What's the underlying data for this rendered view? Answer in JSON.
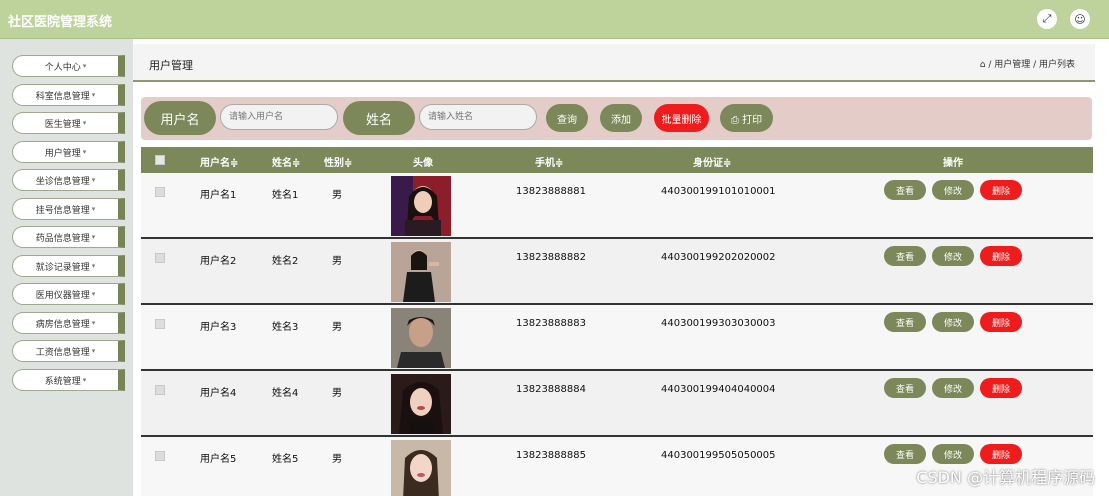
{
  "app_title": "社区医院管理系统",
  "topbar": {
    "fullscreen_icon": "fullscreen-icon",
    "user_icon": "user-icon"
  },
  "sidebar": {
    "items": [
      {
        "label": "个人中心"
      },
      {
        "label": "科室信息管理"
      },
      {
        "label": "医生管理"
      },
      {
        "label": "用户管理"
      },
      {
        "label": "坐诊信息管理"
      },
      {
        "label": "挂号信息管理"
      },
      {
        "label": "药品信息管理"
      },
      {
        "label": "就诊记录管理"
      },
      {
        "label": "医用仪器管理"
      },
      {
        "label": "病房信息管理"
      },
      {
        "label": "工资信息管理"
      },
      {
        "label": "系统管理"
      }
    ]
  },
  "page": {
    "title": "用户管理",
    "breadcrumb": "⌂ / 用户管理 / 用户列表"
  },
  "search": {
    "username_label": "用户名",
    "username_placeholder": "请输入用户名",
    "name_label": "姓名",
    "name_placeholder": "请输入姓名",
    "query": "查询",
    "add": "添加",
    "batch_delete": "批量删除",
    "print": "⎙ 打印"
  },
  "table": {
    "headers": [
      "用户名≑",
      "姓名≑",
      "性别≑",
      "头像",
      "手机≑",
      "身份证≑",
      "操作"
    ],
    "rows": [
      {
        "username": "用户名1",
        "name": "姓名1",
        "gender": "男",
        "phone": "13823888881",
        "id_card": "440300199101010001"
      },
      {
        "username": "用户名2",
        "name": "姓名2",
        "gender": "男",
        "phone": "13823888882",
        "id_card": "440300199202020002"
      },
      {
        "username": "用户名3",
        "name": "姓名3",
        "gender": "男",
        "phone": "13823888883",
        "id_card": "440300199303030003"
      },
      {
        "username": "用户名4",
        "name": "姓名4",
        "gender": "男",
        "phone": "13823888884",
        "id_card": "440300199404040004"
      },
      {
        "username": "用户名5",
        "name": "姓名5",
        "gender": "男",
        "phone": "13823888885",
        "id_card": "440300199505050005"
      }
    ],
    "actions": {
      "view": "查看",
      "edit": "修改",
      "delete": "删除"
    }
  },
  "watermark": "CSDN @计算机程序源码"
}
